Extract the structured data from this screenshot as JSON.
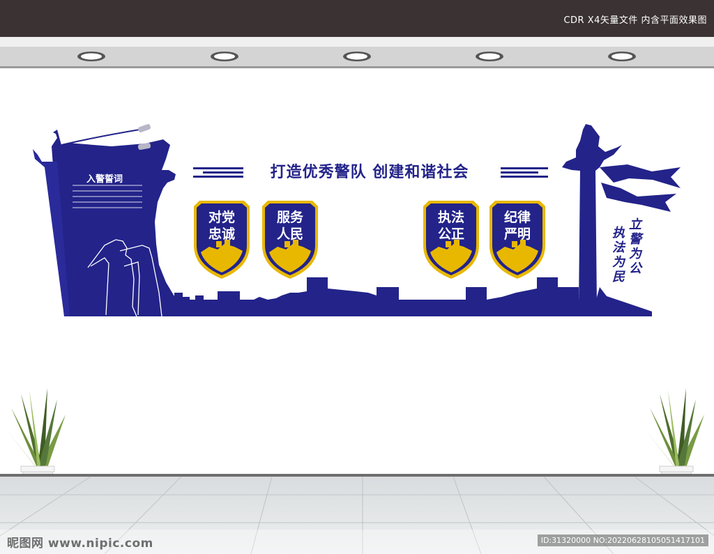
{
  "header": {
    "caption": "CDR X4矢量文件 内含平面效果图"
  },
  "board": {
    "slogan": "打造优秀警队 创建和谐社会",
    "oath_title": "入警誓词",
    "badges": [
      {
        "line1": "对党",
        "line2": "忠诚"
      },
      {
        "line1": "服务",
        "line2": "人民"
      },
      {
        "line1": "执法",
        "line2": "公正"
      },
      {
        "line1": "纪律",
        "line2": "严明"
      }
    ],
    "motto_col1": "立警为公",
    "motto_col2": "执法为民"
  },
  "watermark": {
    "site": "昵图网 www.nipic.com",
    "id_text": "ID:31320000 NO:20220628105051417101"
  },
  "colors": {
    "primary_blue": "#23238a",
    "gold": "#e8b800",
    "topbar": "#3b3233"
  }
}
